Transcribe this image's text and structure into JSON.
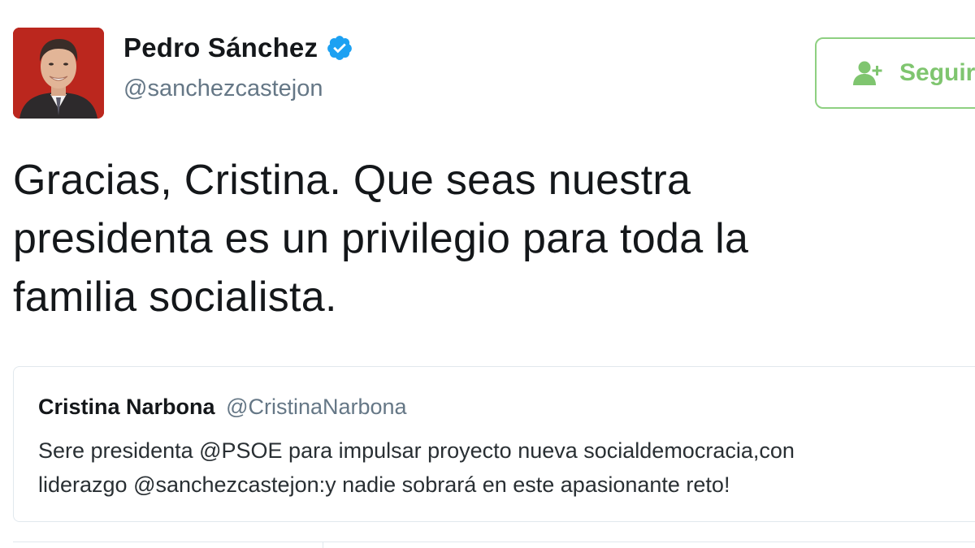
{
  "author": {
    "name": "Pedro Sánchez",
    "handle": "@sanchezcastejon",
    "verified": true
  },
  "follow_button": {
    "label": "Seguir",
    "icon": "add-user-icon"
  },
  "tweet": {
    "lines": [
      "Gracias, Cristina. Que seas nuestra",
      "presidenta es un privilegio para toda la",
      "familia socialista."
    ]
  },
  "quoted": {
    "name": "Cristina Narbona",
    "handle": "@CristinaNarbona",
    "lines": [
      "Sere presidenta @PSOE para impulsar proyecto nueva socialdemocracia,con",
      "liderazgo @sanchezcastejon:y nadie sobrará en este apasionante reto!"
    ]
  },
  "colors": {
    "verified": "#1da1f2",
    "follow_accent": "#7fc56f",
    "avatar_bg": "#b5231b"
  }
}
